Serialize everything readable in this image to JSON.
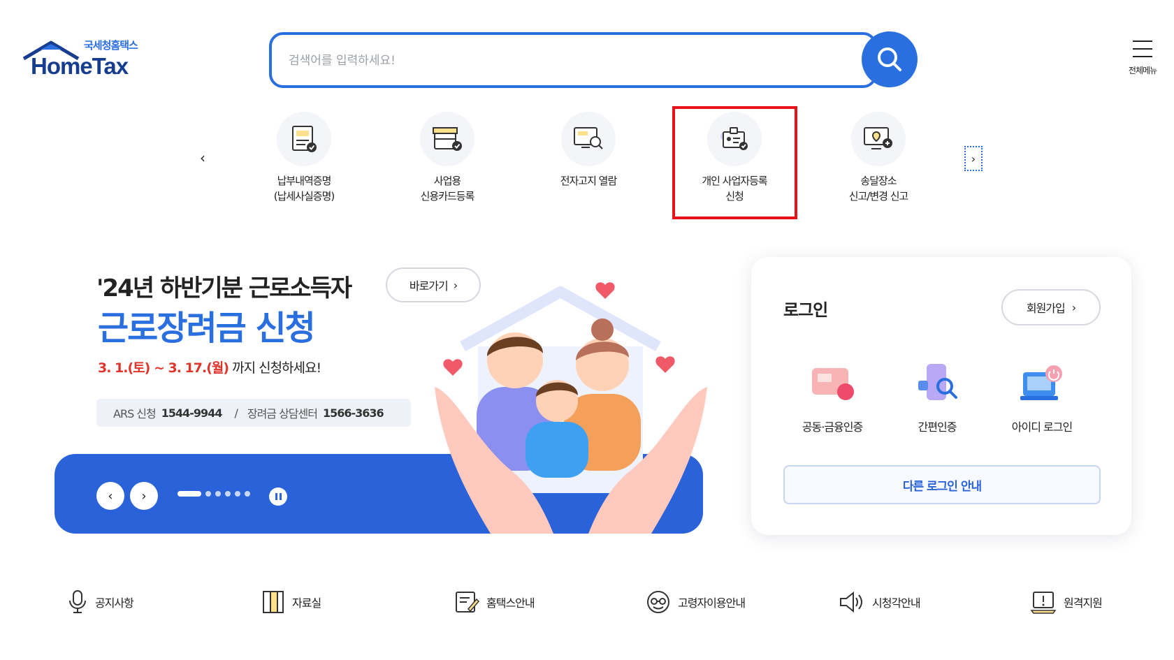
{
  "header": {
    "logo_sub": "국세청홈택스",
    "logo_main": "HomeTax",
    "search_placeholder": "검색어를 입력하세요!",
    "menu_label": "전체메뉴"
  },
  "quick_menu": [
    {
      "line1": "납부내역증명",
      "line2": "(납세사실증명)",
      "icon": "tax-certificate-icon"
    },
    {
      "line1": "사업용",
      "line2": "신용카드등록",
      "icon": "business-card-icon"
    },
    {
      "line1": "전자고지 열람",
      "line2": "",
      "icon": "tax-notice-search-icon"
    },
    {
      "line1": "개인 사업자등록",
      "line2": "신청",
      "icon": "business-registration-icon"
    },
    {
      "line1": "송달장소",
      "line2": "신고/변경 신고",
      "icon": "delivery-location-icon"
    }
  ],
  "banner": {
    "title_line1": "'24년 하반기분 근로소득자",
    "title_line2": "근로장려금 신청",
    "go_label": "바로가기",
    "period_red": "3. 1.(토) ~ 3. 17.(월)",
    "period_rest": "까지 신청하세요!",
    "ars_label": "ARS 신청",
    "ars_number": "1544-9944",
    "separator": "/",
    "center_label": "장려금 상담센터",
    "center_number": "1566-3636"
  },
  "login": {
    "title": "로그인",
    "signup_label": "회원가입",
    "options": [
      {
        "label": "공동·금융인증",
        "icon": "certificate-icon"
      },
      {
        "label": "간편인증",
        "icon": "simple-auth-icon"
      },
      {
        "label": "아이디 로그인",
        "icon": "id-login-icon"
      }
    ],
    "other_login_label": "다른 로그인 안내"
  },
  "bottom_links": [
    {
      "label": "공지사항",
      "icon": "microphone-icon"
    },
    {
      "label": "자료실",
      "icon": "archive-icon"
    },
    {
      "label": "홈택스안내",
      "icon": "guide-icon"
    },
    {
      "label": "고령자이용안내",
      "icon": "senior-icon"
    },
    {
      "label": "시청각안내",
      "icon": "speaker-icon"
    },
    {
      "label": "원격지원",
      "icon": "remote-support-icon"
    }
  ],
  "colors": {
    "brand_blue": "#2a6fe0",
    "banner_blue": "#2a63d9",
    "highlight_red": "#e8121b",
    "period_red": "#e0352b"
  }
}
